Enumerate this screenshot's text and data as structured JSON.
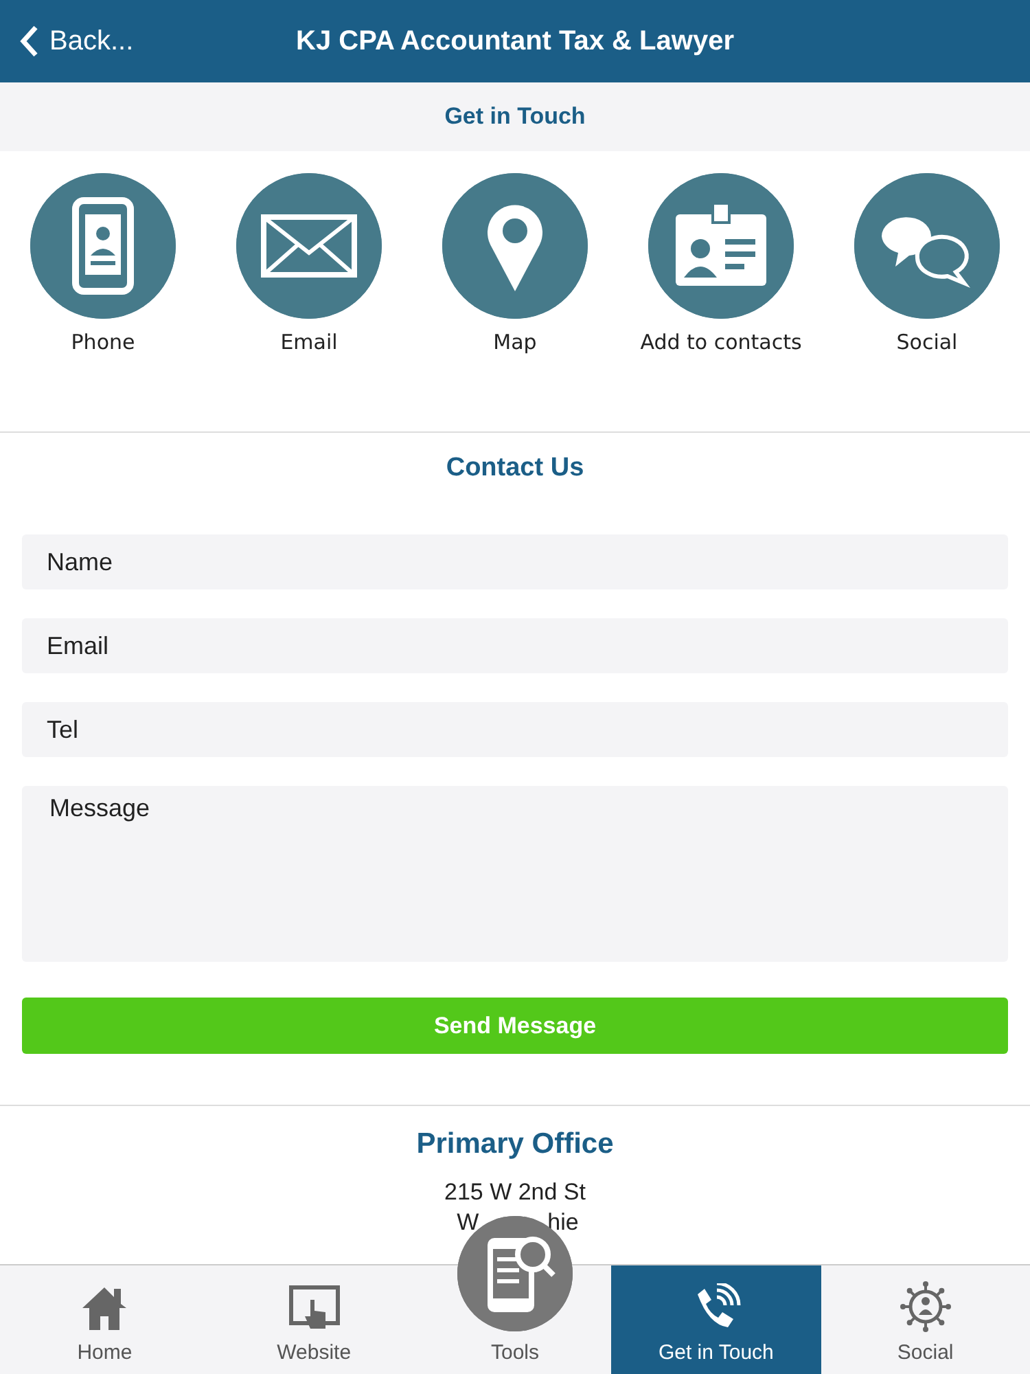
{
  "header": {
    "back": "Back...",
    "title": "KJ CPA Accountant Tax & Lawyer"
  },
  "section_title": "Get in Touch",
  "actions": [
    {
      "kind": "phone",
      "label": "Phone"
    },
    {
      "kind": "email",
      "label": "Email"
    },
    {
      "kind": "map",
      "label": "Map"
    },
    {
      "kind": "contact",
      "label": "Add to contacts"
    },
    {
      "kind": "social",
      "label": "Social"
    }
  ],
  "contact_form": {
    "title": "Contact Us",
    "fields": [
      {
        "kind": "input",
        "placeholder": "Name"
      },
      {
        "kind": "input",
        "placeholder": "Email"
      },
      {
        "kind": "input",
        "placeholder": "Tel"
      },
      {
        "kind": "textarea",
        "placeholder": "Message"
      }
    ],
    "submit": "Send Message"
  },
  "office": {
    "title": "Primary Office",
    "address": [
      "215 W 2nd St"
    ],
    "address_partial": [
      "W",
      "hie"
    ]
  },
  "tab_bar": [
    {
      "kind": "home",
      "label": "Home",
      "selected": false
    },
    {
      "kind": "website",
      "label": "Website",
      "selected": false
    },
    {
      "kind": "tools",
      "label": "Tools",
      "selected": false
    },
    {
      "kind": "phone",
      "label": "Get in Touch",
      "selected": true
    },
    {
      "kind": "social",
      "label": "Social",
      "selected": false
    }
  ]
}
